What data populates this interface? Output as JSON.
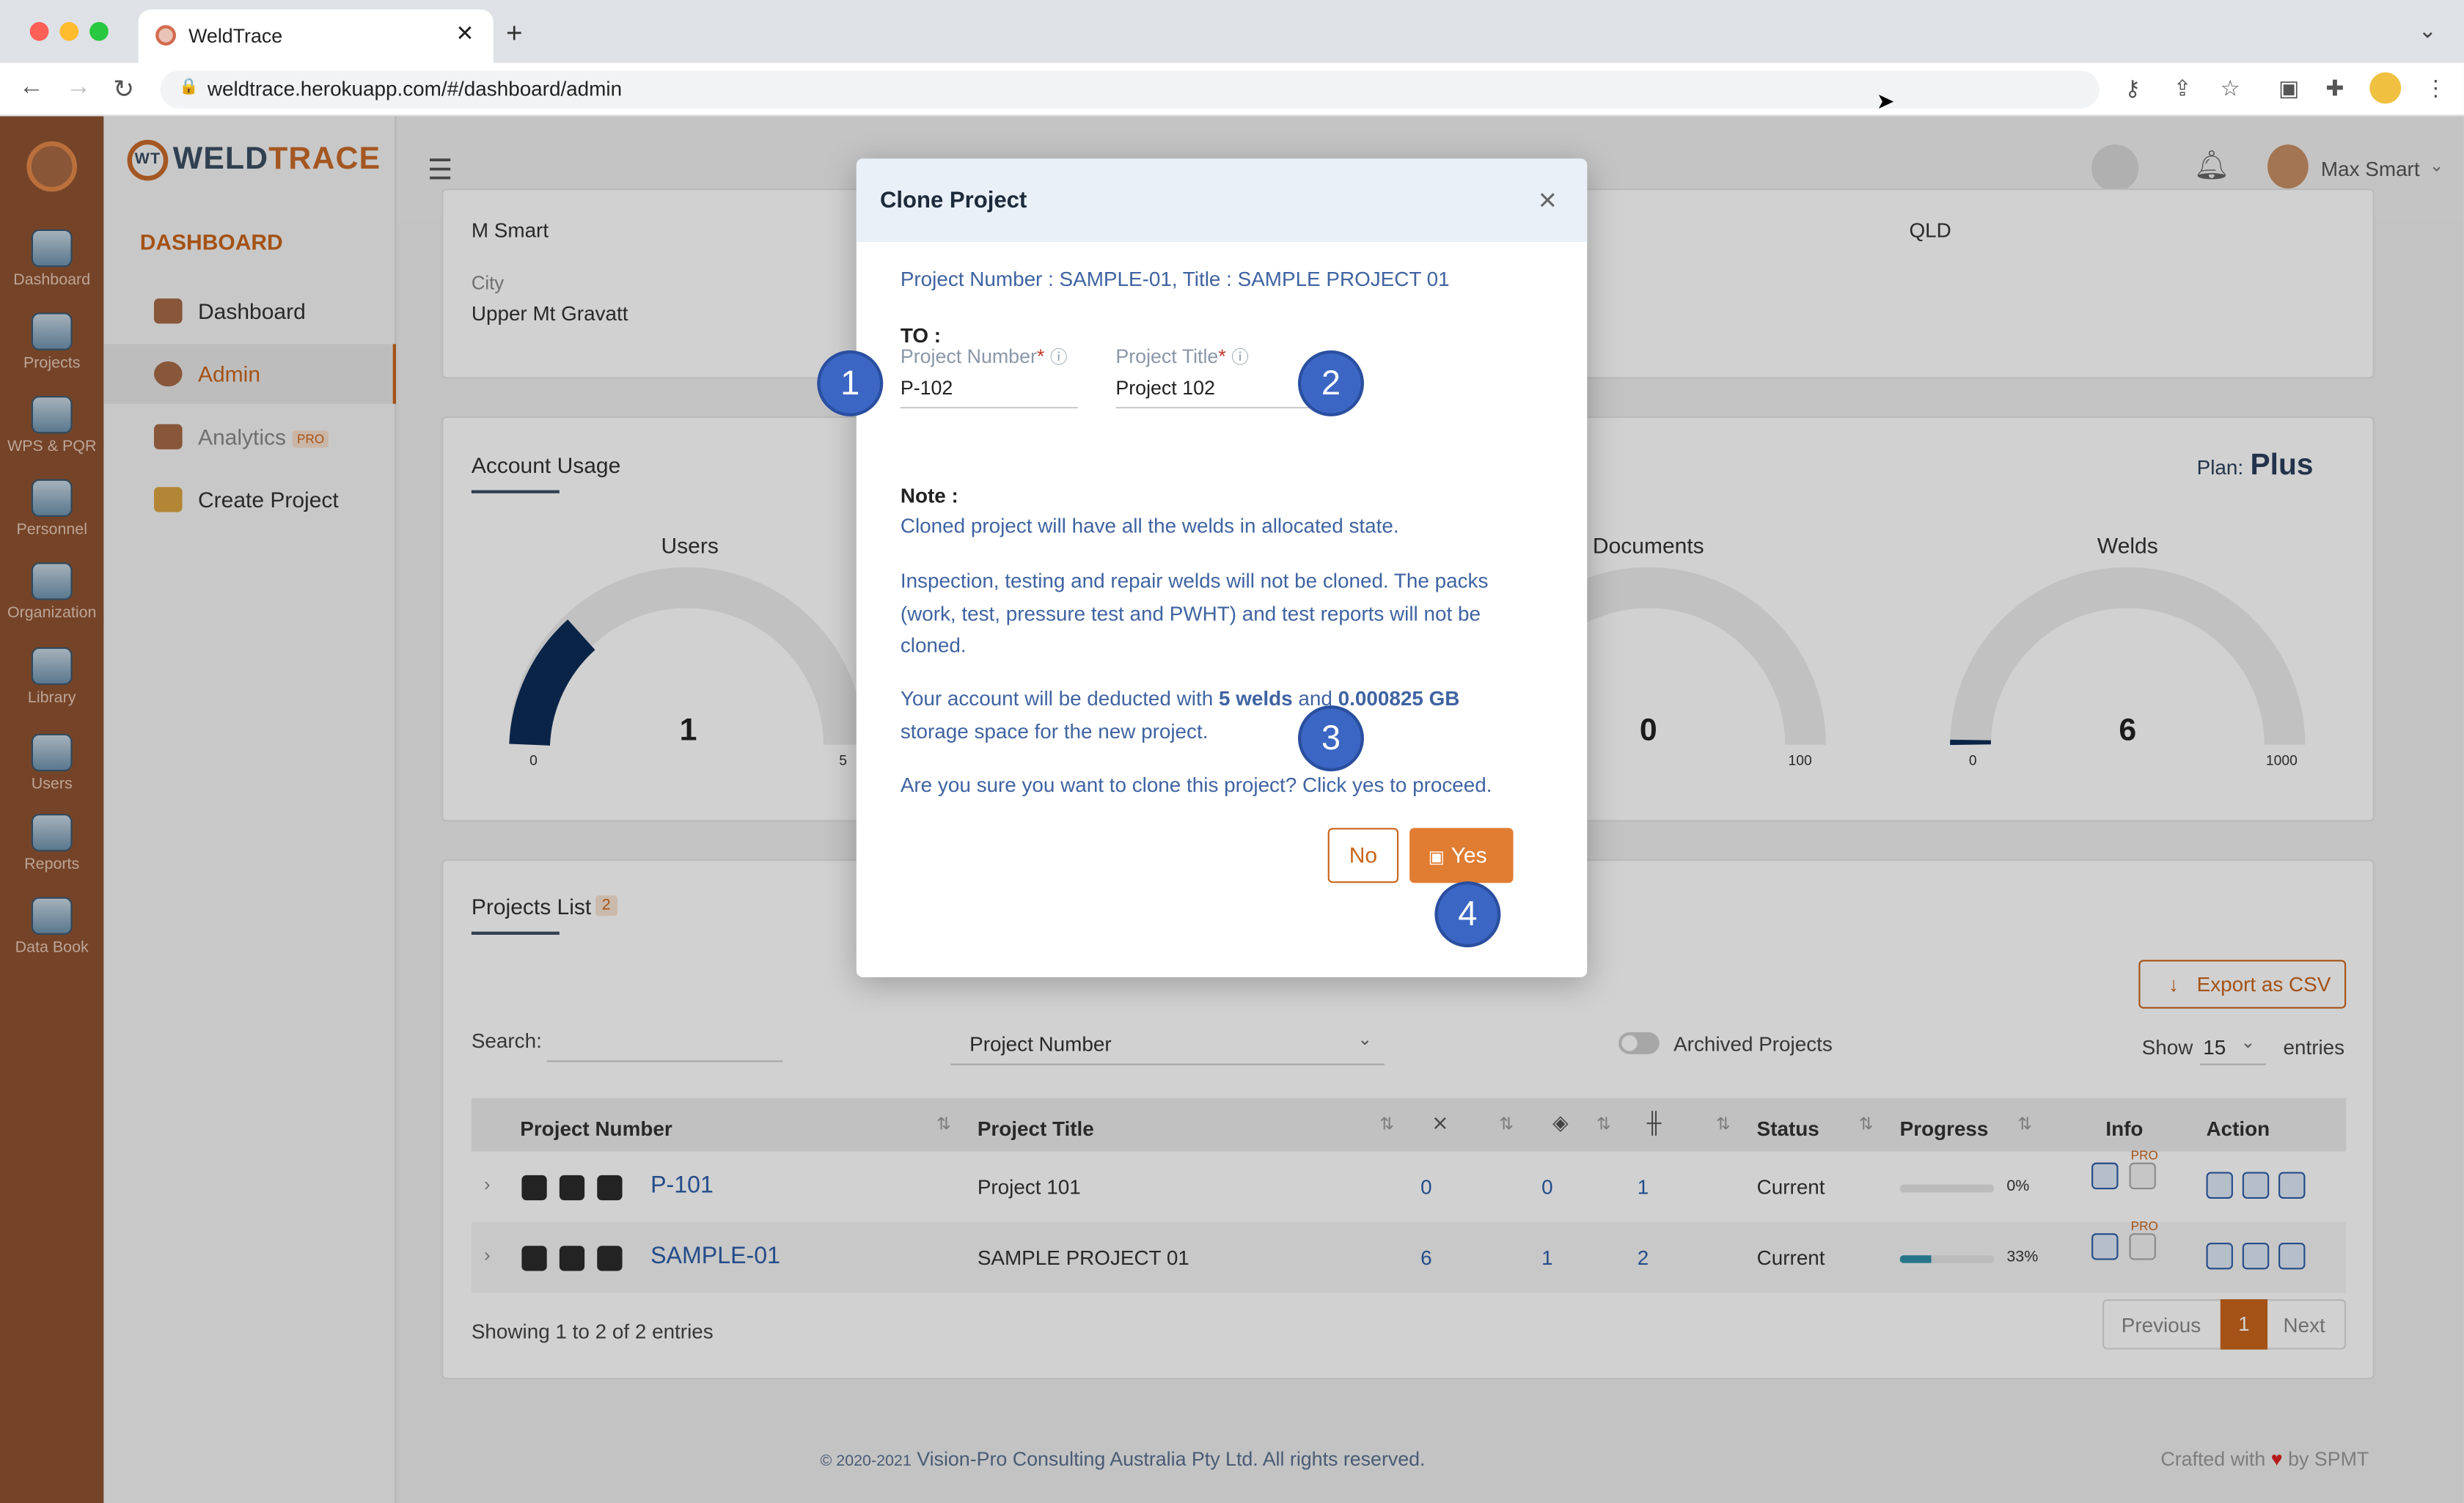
{
  "browser": {
    "tab_title": "WeldTrace",
    "url": "weldtrace.herokuapp.com/#/dashboard/admin"
  },
  "leftbar": [
    {
      "label": "Dashboard"
    },
    {
      "label": "Projects"
    },
    {
      "label": "WPS & PQR"
    },
    {
      "label": "Personnel"
    },
    {
      "label": "Organization"
    },
    {
      "label": "Library"
    },
    {
      "label": "Users"
    },
    {
      "label": "Reports"
    },
    {
      "label": "Data Book"
    }
  ],
  "sidebar": {
    "logo_prefix": "WELD",
    "logo_suffix": "TRACE",
    "logo_mark": "WT",
    "section": "DASHBOARD",
    "items": [
      {
        "label": "Dashboard"
      },
      {
        "label": "Admin"
      },
      {
        "label": "Analytics",
        "badge": "PRO"
      },
      {
        "label": "Create Project"
      }
    ]
  },
  "header": {
    "user_name": "Max Smart"
  },
  "profile": {
    "contact": "M Smart",
    "city_label": "City",
    "city": "Upper Mt Gravatt",
    "state": "QLD"
  },
  "usage": {
    "title": "Account Usage",
    "plan_label": "Plan:",
    "plan": "Plus",
    "gauges": [
      {
        "label": "Users",
        "value": "1",
        "min": "0",
        "max": "5"
      },
      {
        "label": "Documents",
        "value": "0",
        "min": "0",
        "max": "100"
      },
      {
        "label": "Welds",
        "value": "6",
        "min": "0",
        "max": "1000"
      }
    ]
  },
  "projects": {
    "title": "Projects List",
    "count": "2",
    "export_label": "Export as CSV",
    "search_label": "Search:",
    "filter_select": "Project Number",
    "archived_label": "Archived Projects",
    "show_label": "Show",
    "show_value": "15",
    "entries_label": "entries",
    "columns": {
      "number": "Project Number",
      "title": "Project Title",
      "status": "Status",
      "progress": "Progress",
      "info": "Info",
      "action": "Action"
    },
    "rows": [
      {
        "number": "P-101",
        "title": "Project 101",
        "c1": "0",
        "c2": "0",
        "c3": "1",
        "status": "Current",
        "progress": "0%",
        "progress_value": 0
      },
      {
        "number": "SAMPLE-01",
        "title": "SAMPLE PROJECT 01",
        "c1": "6",
        "c2": "1",
        "c3": "2",
        "status": "Current",
        "progress": "33%",
        "progress_value": 0.33
      }
    ],
    "info_badge": "PRO",
    "footer_text": "Showing 1 to 2 of 2 entries",
    "pager": {
      "prev": "Previous",
      "page": "1",
      "next": "Next"
    }
  },
  "footer": {
    "copyright_prefix": "© 2020-2021",
    "copyright": "Vision-Pro Consulting Australia Pty Ltd. All rights reserved.",
    "crafted_prefix": "Crafted with",
    "crafted_suffix": "by SPMT"
  },
  "modal": {
    "title": "Clone Project",
    "source": "Project Number : SAMPLE-01, Title : SAMPLE PROJECT 01",
    "to_label": "TO :",
    "field_number_label": "Project Number",
    "field_number_value": "P-102",
    "field_title_label": "Project Title",
    "field_title_value": "Project 102",
    "note_label": "Note :",
    "note_1": "Cloned project will have all the welds in allocated state.",
    "note_2": "Inspection, testing and repair welds will not be cloned. The packs (work, test, pressure test and PWHT) and test reports will not be cloned.",
    "deduct_prefix": "Your account will be deducted with",
    "deduct_welds": "5 welds",
    "deduct_and": "and",
    "deduct_size": "0.000825 GB",
    "deduct_suffix": "storage space for the new project.",
    "confirm": "Are you sure you want to clone this project? Click yes to proceed.",
    "no_label": "No",
    "yes_label": "Yes"
  },
  "annotations": [
    "1",
    "2",
    "3",
    "4"
  ],
  "colors": {
    "brand_orange": "#c8651b",
    "leftbar": "#8f5331",
    "badge_blue": "#3b66c4",
    "link_blue": "#2c5da8"
  }
}
